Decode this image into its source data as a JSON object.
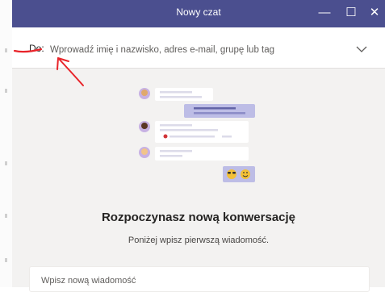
{
  "window": {
    "title": "Nowy czat",
    "controls": {
      "minimize": "—",
      "maximize": "☐",
      "close": "✕"
    }
  },
  "to_field": {
    "label": "Do:",
    "placeholder": "Wprowadź imię i nazwisko, adres e-mail, grupę lub tag"
  },
  "empty_state": {
    "heading": "Rozpoczynasz nową konwersację",
    "subheading": "Poniżej wpisz pierwszą wiadomość."
  },
  "compose": {
    "placeholder": "Wpisz nową wiadomość"
  },
  "colors": {
    "titlebar": "#4b4f8f",
    "accent": "#6264a7",
    "annotation": "#e8242a"
  },
  "icons": {
    "expand": "chevron-down-icon",
    "emoji": [
      "sunglasses-emoji",
      "smiley-emoji"
    ]
  }
}
